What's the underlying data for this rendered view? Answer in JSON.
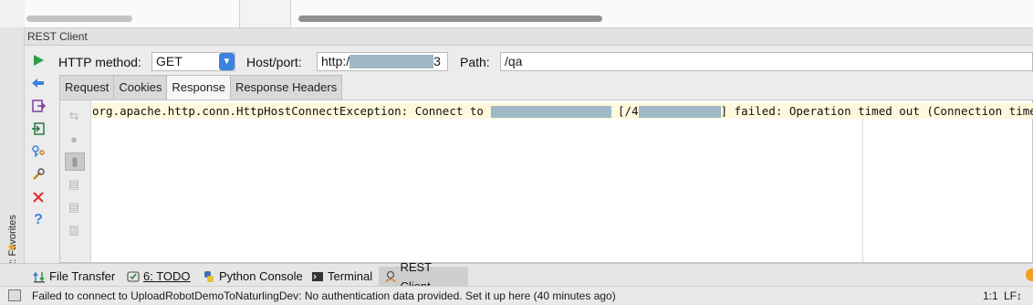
{
  "tool_window": {
    "title": "REST Client"
  },
  "favorites": {
    "label": "2: Favorites"
  },
  "request": {
    "method_label": "HTTP method:",
    "method_value": "GET",
    "host_label": "Host/port:",
    "host_prefix": "http:/",
    "host_suffix": "3",
    "path_label": "Path:",
    "path_value": "/qa"
  },
  "tabs": [
    "Request",
    "Cookies",
    "Response",
    "Response Headers"
  ],
  "response": {
    "part1": "org.apache.http.conn.HttpHostConnectException: Connect to ",
    "part2": " [/4",
    "part3": "] failed: Operation timed out (Connection timed out)"
  },
  "bottom_tabs": [
    {
      "label": "File Transfer",
      "icon": "transfer-icon"
    },
    {
      "label": "6: TODO",
      "icon": "todo-icon"
    },
    {
      "label": "Python Console",
      "icon": "python-icon"
    },
    {
      "label": "Terminal",
      "icon": "terminal-icon"
    },
    {
      "label": "REST Client",
      "icon": "rest-client-icon"
    }
  ],
  "status": {
    "message": "Failed to connect to UploadRobotDemoToNaturlingDev: No authentication data provided. Set it up here (40 minutes ago)",
    "position": "1:1",
    "line_ending": "LF↕"
  },
  "colors": {
    "accent": "#3b82e0",
    "run_green": "#2ea043",
    "error_bg": "#fff8dc",
    "close_red": "#e03030",
    "help_blue": "#3b82e0"
  }
}
